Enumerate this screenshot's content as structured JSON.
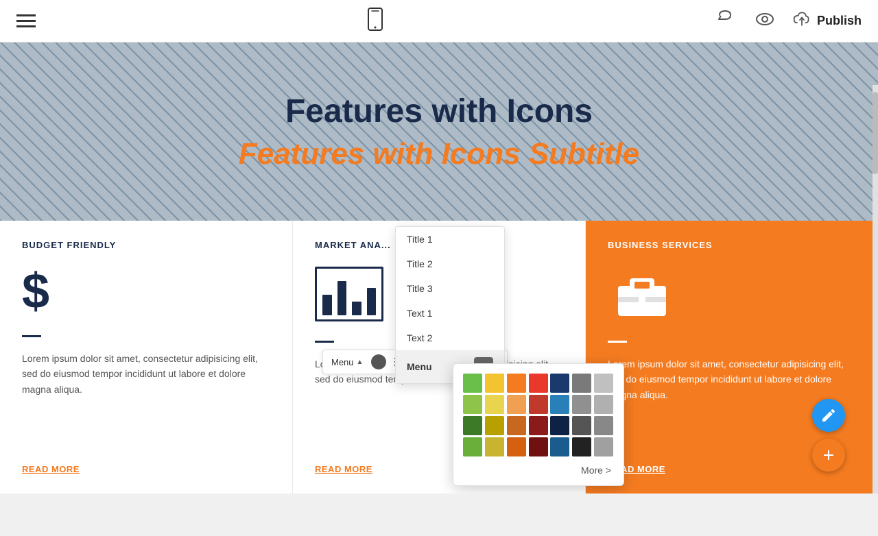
{
  "toolbar": {
    "publish_label": "Publish"
  },
  "hero": {
    "title": "Features with Icons",
    "subtitle": "Features with Icons Subtitle"
  },
  "cards": [
    {
      "id": "budget",
      "title": "BUDGET FRIENDLY",
      "icon_type": "dollar",
      "text": "Lorem ipsum dolor sit amet, consectetur adipisicing elit, sed do eiusmod tempor incididunt ut labore et dolore magna aliqua.",
      "link": "READ MORE",
      "type": "white"
    },
    {
      "id": "market",
      "title": "MARKET ANA...",
      "icon_type": "barchart",
      "text": "Lorem ipsum dolor sit amet, consectetur adipisicing elit, sed do eiusmod tempor incididunt ut labore et dolore m...",
      "link": "READ MORE",
      "type": "white"
    },
    {
      "id": "business",
      "title": "BUSINESS SERVICES",
      "icon_type": "briefcase",
      "text": "Lorem ipsum dolor sit amet, consectetur adipisicing elit, sed do eiusmod tempor incididunt ut labore et dolore magna aliqua.",
      "link": "READ MORE",
      "type": "orange"
    }
  ],
  "dropdown": {
    "items": [
      {
        "label": "Title 1",
        "id": "title1"
      },
      {
        "label": "Title 2",
        "id": "title2"
      },
      {
        "label": "Title 3",
        "id": "title3"
      },
      {
        "label": "Text 1",
        "id": "text1"
      },
      {
        "label": "Text 2",
        "id": "text2"
      },
      {
        "label": "Menu",
        "id": "menu",
        "active": true
      }
    ]
  },
  "menu_bar": {
    "label": "Menu"
  },
  "color_picker": {
    "more_label": "More >",
    "colors": [
      "#6abf4b",
      "#f4c430",
      "#f47b20",
      "#e8392c",
      "#1a3a6e",
      "#7a7a7a",
      "#c0c0c0",
      "#8ec44a",
      "#e8d44d",
      "#f0a050",
      "#c0392b",
      "#2980b9",
      "#909090",
      "#b0b0b0",
      "#3d7a28",
      "#b8a000",
      "#c86820",
      "#8b1a1a",
      "#0d2244",
      "#555555",
      "#888888",
      "#6aaf3a",
      "#c8b430",
      "#d46010",
      "#701010",
      "#1a5c8e",
      "#222222",
      "#a0a0a0"
    ]
  }
}
